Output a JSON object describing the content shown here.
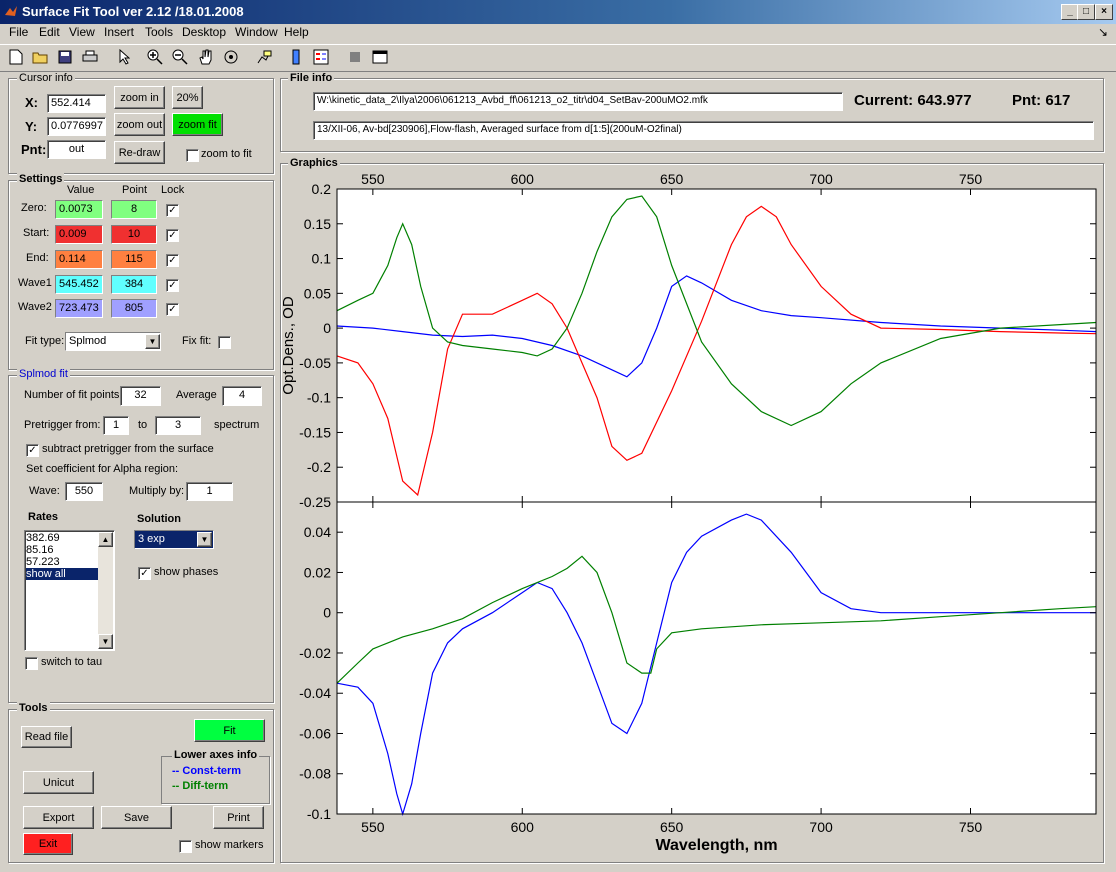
{
  "window": {
    "title": "Surface Fit Tool ver 2.12 /18.01.2008",
    "min": "_",
    "max": "□",
    "close": "×"
  },
  "menu": [
    "File",
    "Edit",
    "View",
    "Insert",
    "Tools",
    "Desktop",
    "Window",
    "Help"
  ],
  "menu_arrow": "↘",
  "cursor": {
    "title": "Cursor info",
    "x_label": "X:",
    "x_value": "552.414",
    "y_label": "Y:",
    "y_value": "0.0776997",
    "pnt_label": "Pnt:",
    "pnt_value": "out",
    "zoom_in": "zoom in",
    "zoom_out": "zoom out",
    "redraw": "Re-draw",
    "pct": "20%",
    "zoom_fit": "zoom fit",
    "zoom_to_fit": "zoom to fit",
    "zoom_fit_color": "#00e000"
  },
  "settings": {
    "title": "Settings",
    "col_value": "Value",
    "col_point": "Point",
    "col_lock": "Lock",
    "rows": [
      {
        "label": "Zero:",
        "value": "0.0073",
        "point": "8",
        "color": "#80ff80"
      },
      {
        "label": "Start:",
        "value": "0.009",
        "point": "10",
        "color": "#f03030"
      },
      {
        "label": "End:",
        "value": "0.114",
        "point": "115",
        "color": "#ff8040"
      },
      {
        "label": "Wave1",
        "value": "545.452",
        "point": "384",
        "color": "#60ffff"
      },
      {
        "label": "Wave2",
        "value": "723.473",
        "point": "805",
        "color": "#a0a0ff"
      }
    ],
    "fit_type_label": "Fit type:",
    "fit_type_value": "Splmod",
    "fix_fit_label": "Fix fit:"
  },
  "splmod": {
    "title": "Splmod fit",
    "nfit_label": "Number of fit points",
    "nfit_value": "32",
    "avg_label": "Average",
    "avg_value": "4",
    "pretrig_label": "Pretrigger from:",
    "pretrig_from": "1",
    "to_label": "to",
    "pretrig_to": "3",
    "spectrum_label": "spectrum",
    "subtract_label": "subtract pretrigger from the surface",
    "alpha_label": "Set coefficient for Alpha region:",
    "wave_label": "Wave:",
    "wave_value": "550",
    "mult_label": "Multiply by:",
    "mult_value": "1",
    "rates_label": "Rates",
    "rates": [
      "382.69",
      "85.16",
      "57.223",
      "show all"
    ],
    "solution_label": "Solution",
    "solution_value": "3 exp",
    "show_phases": "show phases",
    "switch_tau": "switch to tau"
  },
  "tools": {
    "title": "Tools",
    "read_file": "Read file",
    "fit": "Fit",
    "unicut": "Unicut",
    "export": "Export",
    "save": "Save",
    "print": "Print",
    "exit": "Exit",
    "show_markers": "show markers",
    "lower_info_title": "Lower axes info",
    "const_term": "-- Const-term",
    "diff_term": "-- Diff-term",
    "fit_color": "#00ff40",
    "exit_color": "#ff2020"
  },
  "fileinfo": {
    "title": "File info",
    "path": "W:\\kinetic_data_2\\Ilya\\2006\\061213_Avbd_ff\\061213_o2_titr\\d04_SetBav-200uMO2.mfk",
    "current": "Current: 643.977",
    "pnt": "Pnt: 617",
    "description": "13/XII-06, Av-bd[230906],Flow-flash, Averaged surface from d[1:5](200uM-O2final)"
  },
  "graphics_title": "Graphics",
  "chart_data": [
    {
      "type": "line",
      "title": "",
      "xlabel": "",
      "ylabel": "Opt.Dens., OD",
      "xlim": [
        538,
        792
      ],
      "ylim": [
        -0.25,
        0.2
      ],
      "x_ticks": [
        "550",
        "600",
        "650",
        "700",
        "750"
      ],
      "y_ticks": [
        "0.2",
        "0.15",
        "0.1",
        "0.05",
        "0",
        "-0.05",
        "-0.1",
        "-0.15",
        "-0.2",
        "-0.25"
      ],
      "grid": false,
      "series": [
        {
          "color": "#0000ff",
          "x": [
            538,
            550,
            560,
            570,
            580,
            590,
            600,
            610,
            620,
            630,
            635,
            640,
            645,
            650,
            655,
            660,
            670,
            680,
            690,
            700,
            720,
            740,
            760,
            780,
            792
          ],
          "y": [
            0.003,
            0.0,
            -0.005,
            -0.01,
            -0.012,
            -0.01,
            -0.015,
            -0.025,
            -0.04,
            -0.06,
            -0.07,
            -0.05,
            0.0,
            0.06,
            0.075,
            0.065,
            0.04,
            0.025,
            0.018,
            0.015,
            0.008,
            0.003,
            0.0,
            -0.003,
            -0.005
          ]
        },
        {
          "color": "#ff0000",
          "x": [
            538,
            545,
            550,
            555,
            560,
            565,
            570,
            575,
            580,
            590,
            600,
            605,
            610,
            615,
            620,
            625,
            630,
            635,
            640,
            650,
            660,
            670,
            675,
            680,
            685,
            690,
            700,
            710,
            720,
            740,
            760,
            780,
            792
          ],
          "y": [
            -0.04,
            -0.05,
            -0.08,
            -0.13,
            -0.22,
            -0.24,
            -0.15,
            -0.03,
            0.02,
            0.02,
            0.04,
            0.05,
            0.035,
            0.0,
            -0.05,
            -0.1,
            -0.17,
            -0.19,
            -0.18,
            -0.09,
            0.01,
            0.12,
            0.16,
            0.175,
            0.16,
            0.12,
            0.06,
            0.02,
            0.0,
            -0.002,
            -0.005,
            -0.007,
            -0.008
          ]
        },
        {
          "color": "#008000",
          "x": [
            538,
            545,
            550,
            555,
            558,
            560,
            563,
            566,
            570,
            575,
            580,
            590,
            600,
            605,
            610,
            615,
            620,
            625,
            630,
            635,
            640,
            645,
            650,
            660,
            670,
            680,
            690,
            700,
            710,
            720,
            740,
            760,
            780,
            792
          ],
          "y": [
            0.025,
            0.04,
            0.05,
            0.09,
            0.13,
            0.15,
            0.12,
            0.06,
            0.0,
            -0.02,
            -0.025,
            -0.03,
            -0.035,
            -0.04,
            -0.03,
            -0.0,
            0.05,
            0.11,
            0.16,
            0.185,
            0.19,
            0.16,
            0.09,
            -0.02,
            -0.08,
            -0.12,
            -0.14,
            -0.12,
            -0.08,
            -0.05,
            -0.015,
            0.0,
            0.005,
            0.008
          ]
        }
      ]
    },
    {
      "type": "line",
      "title": "",
      "xlabel": "Wavelength, nm",
      "ylabel": "",
      "xlim": [
        538,
        792
      ],
      "ylim": [
        -0.1,
        0.055
      ],
      "x_ticks": [
        "550",
        "600",
        "650",
        "700",
        "750"
      ],
      "y_ticks": [
        "0.04",
        "0.02",
        "0",
        "-0.02",
        "-0.04",
        "-0.06",
        "-0.08",
        "-0.1"
      ],
      "grid": false,
      "series": [
        {
          "color": "#0000ff",
          "x": [
            538,
            545,
            550,
            555,
            558,
            560,
            563,
            566,
            570,
            575,
            580,
            590,
            600,
            605,
            610,
            615,
            620,
            625,
            630,
            635,
            640,
            645,
            650,
            655,
            660,
            670,
            675,
            680,
            690,
            700,
            710,
            720,
            740,
            760,
            780,
            792
          ],
          "y": [
            -0.035,
            -0.037,
            -0.045,
            -0.07,
            -0.09,
            -0.1,
            -0.085,
            -0.06,
            -0.03,
            -0.015,
            -0.008,
            0.0,
            0.01,
            0.015,
            0.012,
            0.0,
            -0.015,
            -0.035,
            -0.055,
            -0.06,
            -0.045,
            -0.015,
            0.015,
            0.03,
            0.038,
            0.046,
            0.049,
            0.046,
            0.03,
            0.01,
            0.002,
            0.0,
            0.0,
            0.0,
            0.0,
            0.0
          ]
        },
        {
          "color": "#008000",
          "x": [
            538,
            545,
            550,
            555,
            560,
            570,
            580,
            590,
            600,
            610,
            615,
            620,
            625,
            630,
            635,
            640,
            643,
            645,
            650,
            660,
            670,
            680,
            700,
            720,
            740,
            760,
            780,
            792
          ],
          "y": [
            -0.035,
            -0.025,
            -0.018,
            -0.015,
            -0.012,
            -0.008,
            -0.003,
            0.005,
            0.012,
            0.018,
            0.022,
            0.028,
            0.02,
            0.0,
            -0.025,
            -0.03,
            -0.03,
            -0.018,
            -0.01,
            -0.008,
            -0.007,
            -0.006,
            -0.005,
            -0.004,
            -0.002,
            0.0,
            0.002,
            0.003
          ]
        }
      ]
    }
  ]
}
